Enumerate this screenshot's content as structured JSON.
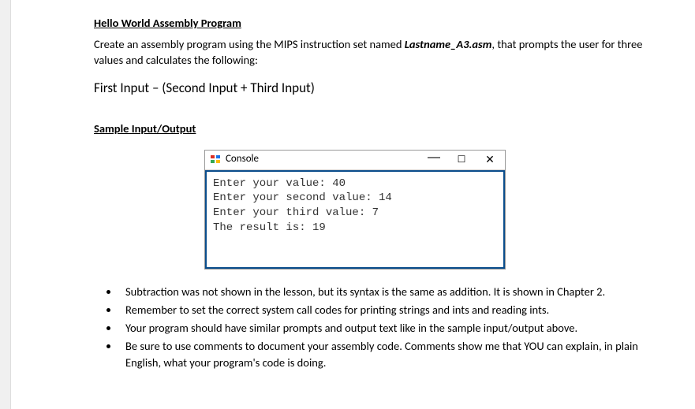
{
  "title": "Hello World Assembly Program",
  "intro_pre": "Create an assembly program using the MIPS instruction set named ",
  "filename": "Lastname_A3.asm",
  "intro_post": ", that prompts the user for three values and calculates the following:",
  "formula": "First Input – (Second Input + Third Input)",
  "sample_heading": "Sample Input/Output",
  "console": {
    "title": "Console",
    "lines": [
      "Enter your value: 40",
      "Enter your second value: 14",
      "Enter your third value: 7",
      "The result is: 19"
    ]
  },
  "bullets": [
    "Subtraction was not shown in the lesson, but its syntax is the same as addition. It is shown in Chapter 2.",
    "Remember to set the correct system call codes for printing strings and ints and reading ints.",
    "Your program should have similar prompts and output text like in the sample input/output above.",
    "Be sure to use comments to document your assembly code. Comments show me that YOU can explain, in plain English, what your program's code is doing."
  ]
}
